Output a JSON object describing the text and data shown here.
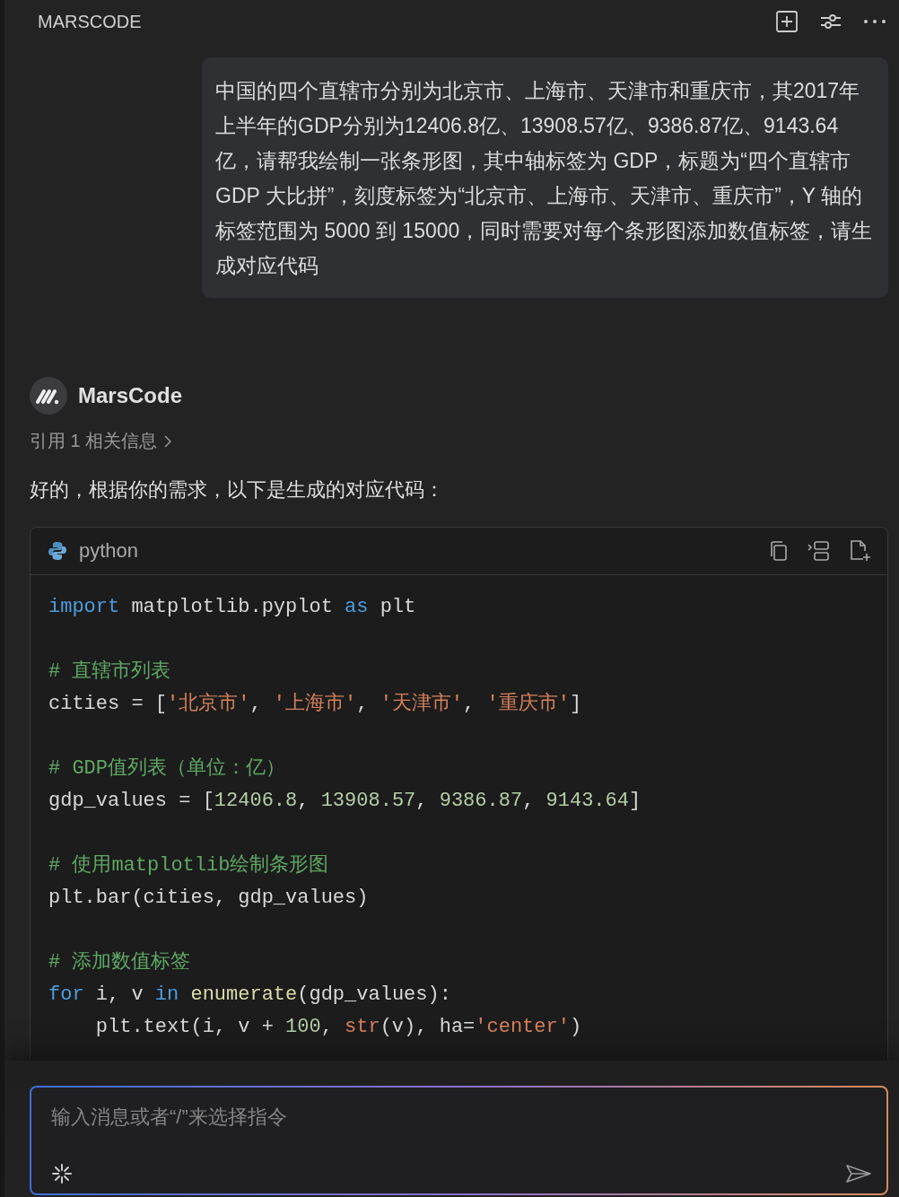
{
  "header": {
    "title": "MARSCODE"
  },
  "user_message": "中国的四个直辖市分别为北京市、上海市、天津市和重庆市，其2017年上半年的GDP分别为12406.8亿、13908.57亿、9386.87亿、9143.64亿，请帮我绘制一张条形图，其中轴标签为 GDP，标题为“四个直辖市 GDP 大比拼”，刻度标签为“北京市、上海市、天津市、重庆市”，Y 轴的标签范围为 5000 到 15000，同时需要对每个条形图添加数值标签，请生成对应代码",
  "assistant": {
    "name": "MarsCode",
    "reference": "引用 1 相关信息",
    "reply": "好的，根据你的需求，以下是生成的对应代码："
  },
  "code_block": {
    "language": "python",
    "paragraphs": [
      [
        [
          {
            "kind": "keyword",
            "text": "import"
          },
          {
            "kind": "plain",
            "text": " matplotlib.pyplot "
          },
          {
            "kind": "keyword",
            "text": "as"
          },
          {
            "kind": "plain",
            "text": " plt"
          }
        ]
      ],
      [
        [
          {
            "kind": "comment",
            "text": "# 直辖市列表"
          }
        ],
        [
          {
            "kind": "plain",
            "text": "cities = ["
          },
          {
            "kind": "string",
            "text": "'北京市'"
          },
          {
            "kind": "plain",
            "text": ", "
          },
          {
            "kind": "string",
            "text": "'上海市'"
          },
          {
            "kind": "plain",
            "text": ", "
          },
          {
            "kind": "string",
            "text": "'天津市'"
          },
          {
            "kind": "plain",
            "text": ", "
          },
          {
            "kind": "string",
            "text": "'重庆市'"
          },
          {
            "kind": "plain",
            "text": "]"
          }
        ]
      ],
      [
        [
          {
            "kind": "comment",
            "text": "# GDP值列表（单位：亿）"
          }
        ],
        [
          {
            "kind": "plain",
            "text": "gdp_values = ["
          },
          {
            "kind": "number",
            "text": "12406.8"
          },
          {
            "kind": "plain",
            "text": ", "
          },
          {
            "kind": "number",
            "text": "13908.57"
          },
          {
            "kind": "plain",
            "text": ", "
          },
          {
            "kind": "number",
            "text": "9386.87"
          },
          {
            "kind": "plain",
            "text": ", "
          },
          {
            "kind": "number",
            "text": "9143.64"
          },
          {
            "kind": "plain",
            "text": "]"
          }
        ]
      ],
      [
        [
          {
            "kind": "comment",
            "text": "# 使用matplotlib绘制条形图"
          }
        ],
        [
          {
            "kind": "plain",
            "text": "plt.bar(cities, gdp_values)"
          }
        ]
      ],
      [
        [
          {
            "kind": "comment",
            "text": "# 添加数值标签"
          }
        ],
        [
          {
            "kind": "keyword",
            "text": "for"
          },
          {
            "kind": "plain",
            "text": " i, v "
          },
          {
            "kind": "keyword",
            "text": "in"
          },
          {
            "kind": "function",
            "text": " enumerate"
          },
          {
            "kind": "plain",
            "text": "(gdp_values):"
          }
        ],
        [
          {
            "kind": "plain",
            "text": "    plt.text(i, v + "
          },
          {
            "kind": "number",
            "text": "100"
          },
          {
            "kind": "plain",
            "text": ", "
          },
          {
            "kind": "builtin",
            "text": "str"
          },
          {
            "kind": "plain",
            "text": "(v), ha="
          },
          {
            "kind": "string",
            "text": "'center'"
          },
          {
            "kind": "plain",
            "text": ")"
          }
        ]
      ]
    ]
  },
  "input": {
    "placeholder": "输入消息或者“/”来选择指令"
  }
}
